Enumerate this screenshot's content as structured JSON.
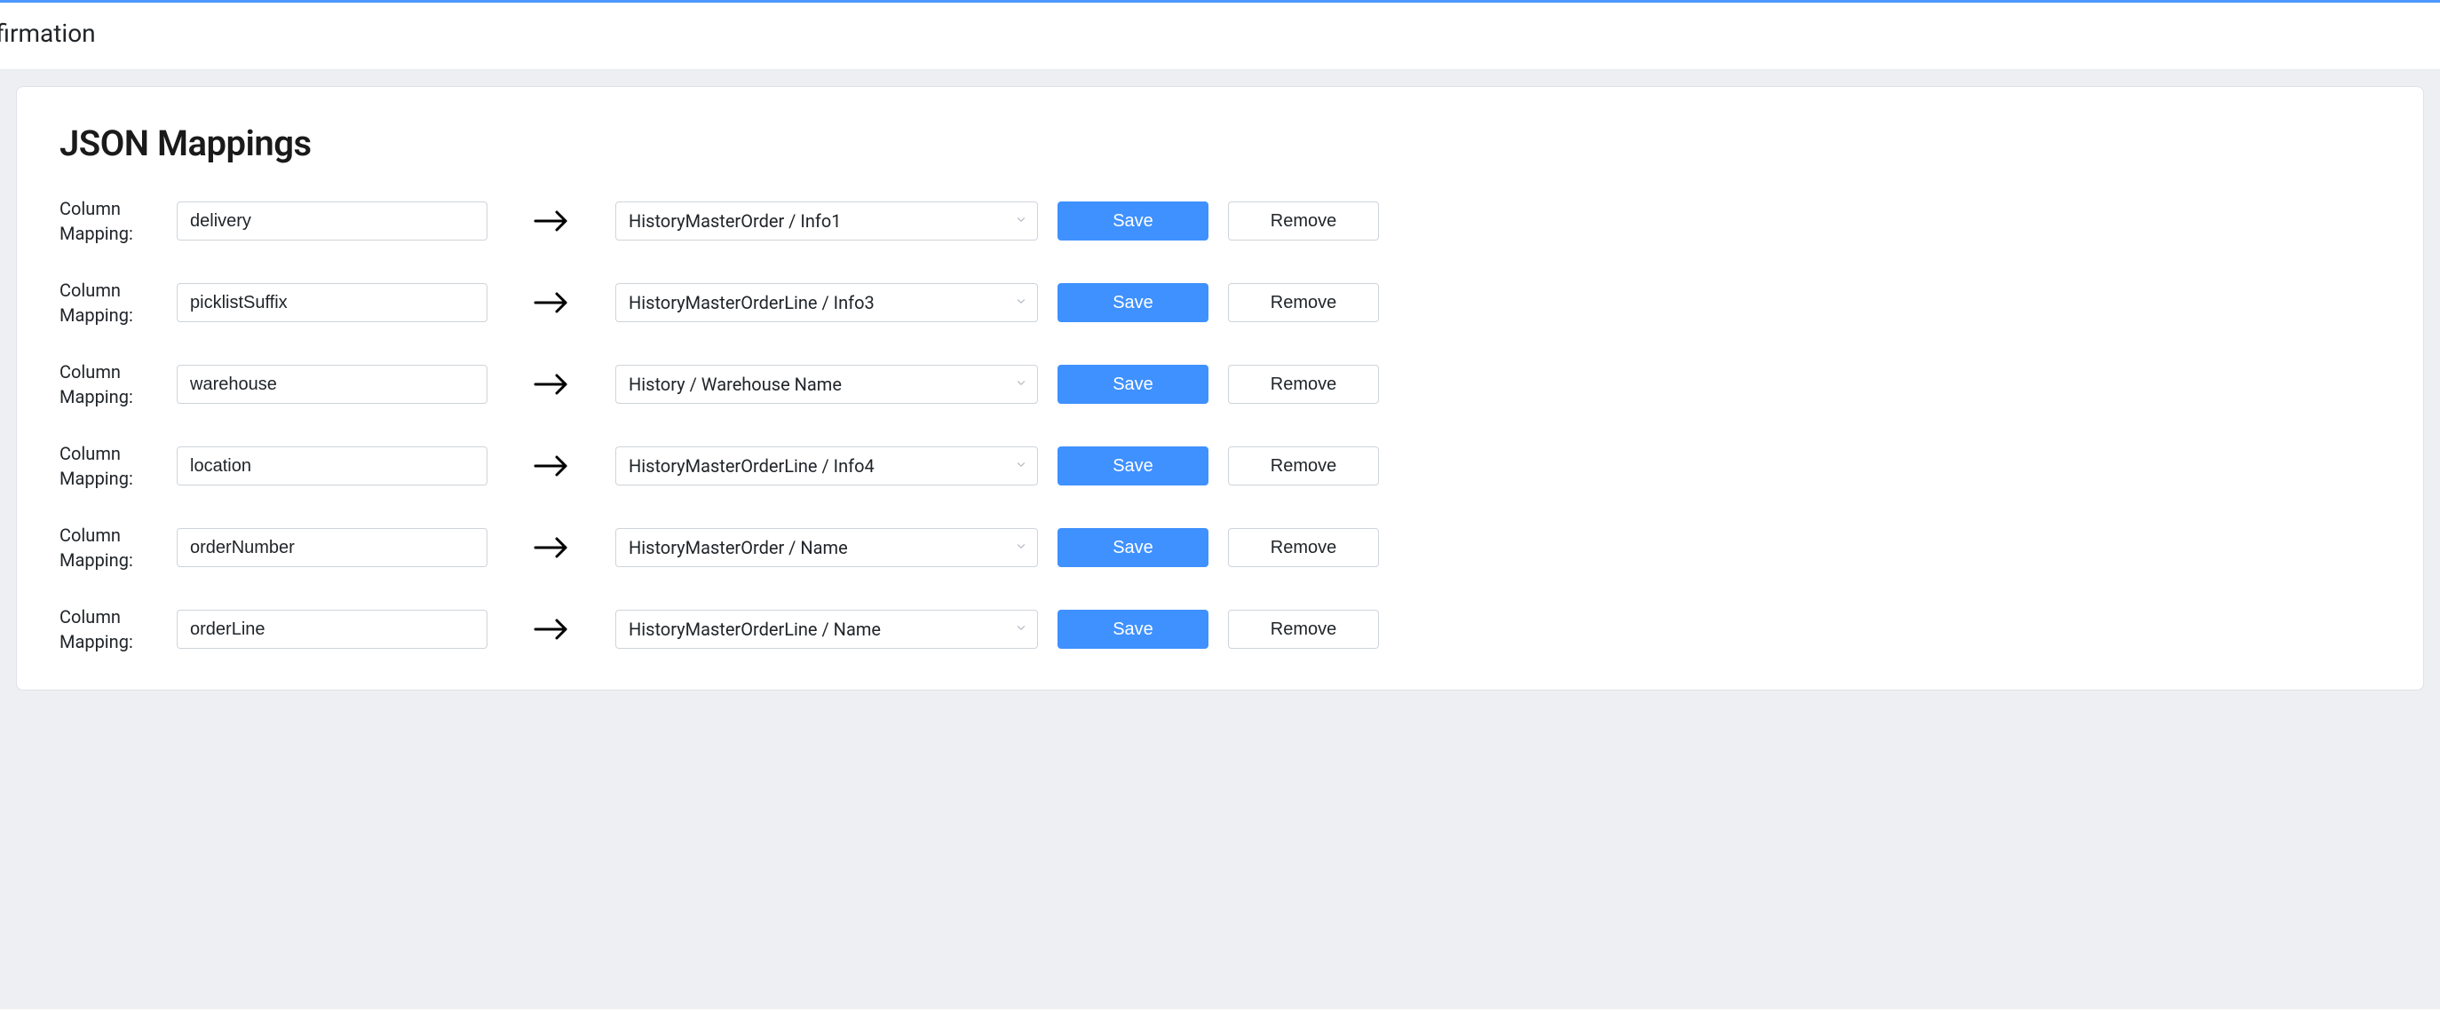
{
  "header": {
    "breadcrumb_visible_fragment": "onfirmation"
  },
  "card": {
    "title": "JSON Mappings"
  },
  "row_label": "Column Mapping:",
  "buttons": {
    "save": "Save",
    "remove": "Remove"
  },
  "rows": [
    {
      "source": "delivery",
      "target": "HistoryMasterOrder / Info1"
    },
    {
      "source": "picklistSuffix",
      "target": "HistoryMasterOrderLine / Info3"
    },
    {
      "source": "warehouse",
      "target": "History / Warehouse Name"
    },
    {
      "source": "location",
      "target": "HistoryMasterOrderLine / Info4"
    },
    {
      "source": "orderNumber",
      "target": "HistoryMasterOrder / Name"
    },
    {
      "source": "orderLine",
      "target": "HistoryMasterOrderLine / Name"
    }
  ]
}
